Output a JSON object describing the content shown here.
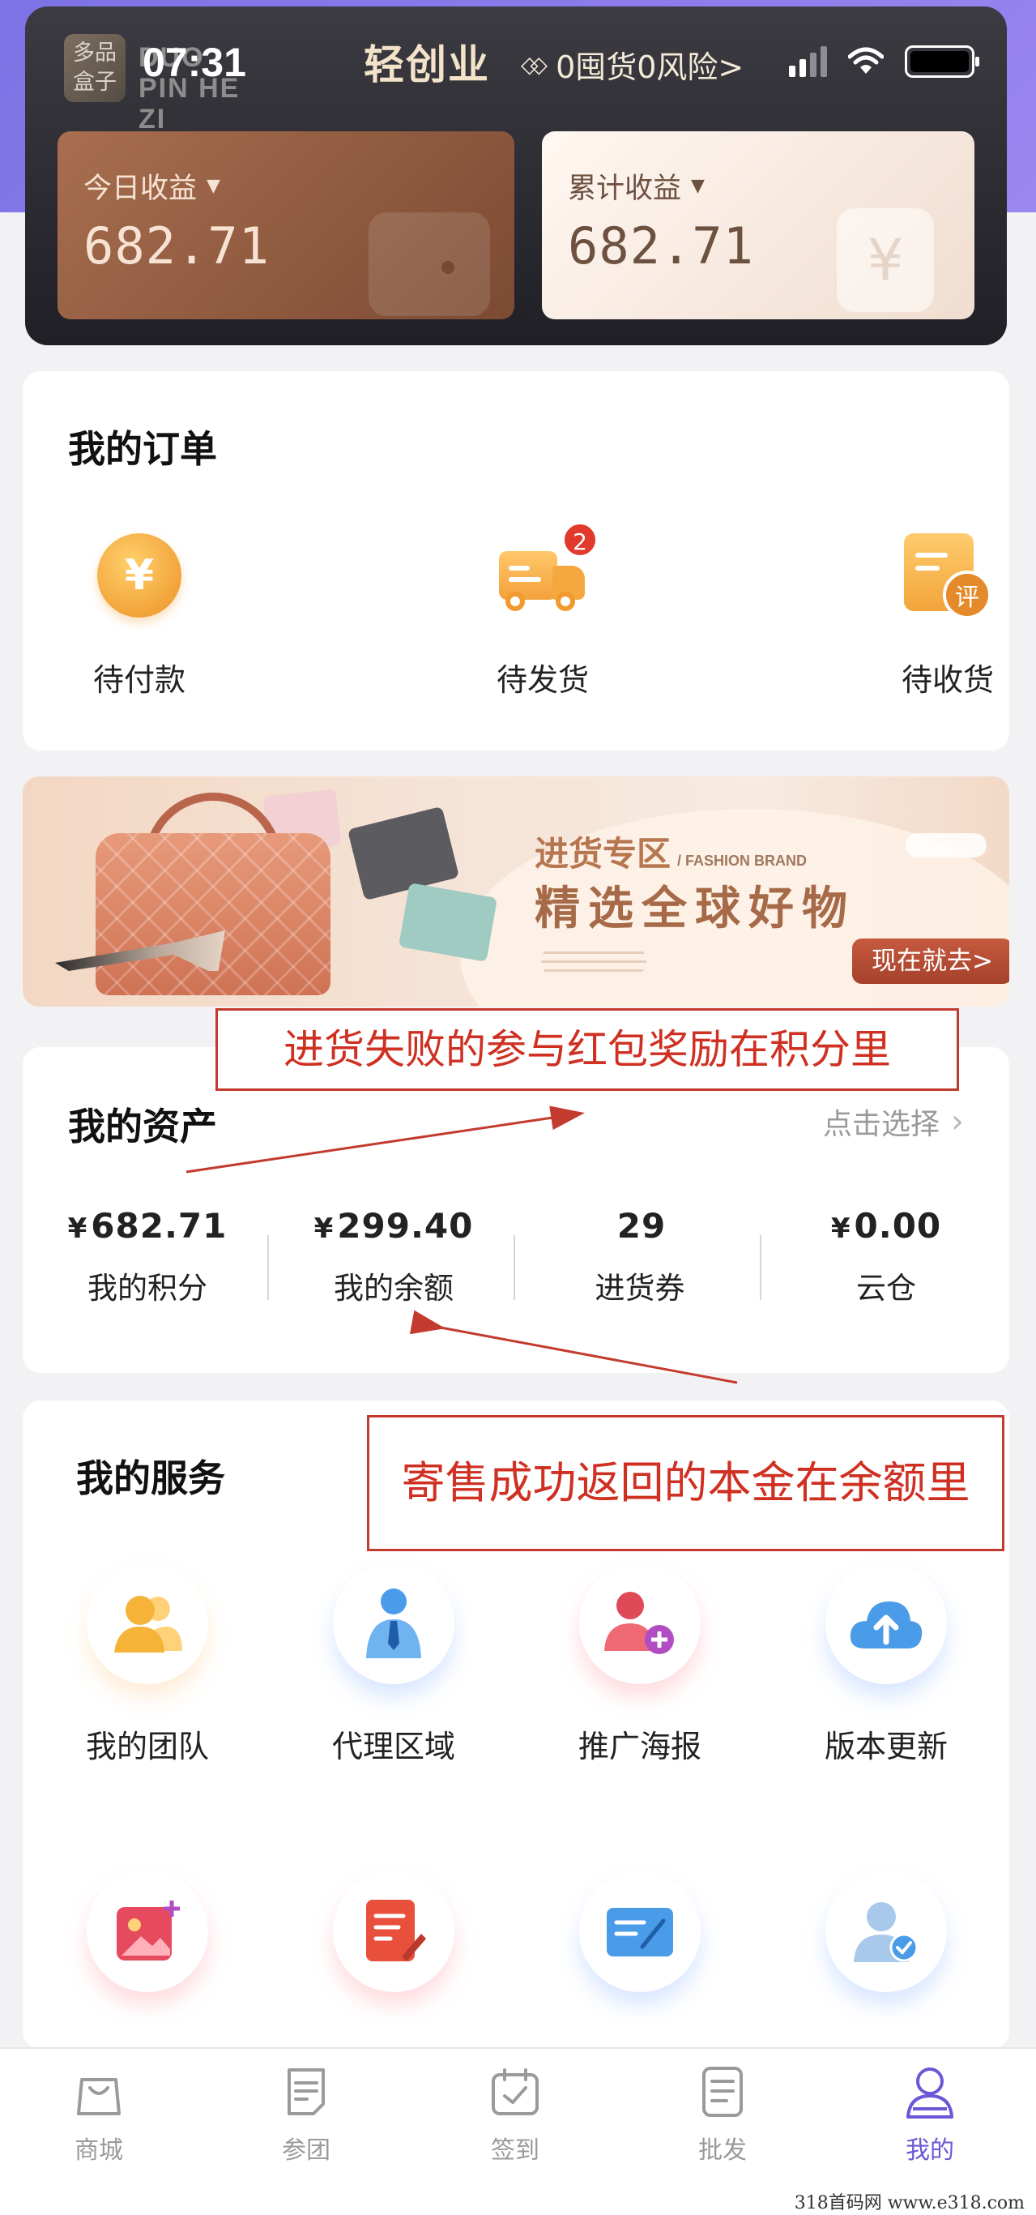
{
  "status_bar": {
    "time": "07:31"
  },
  "brand": {
    "logo_text": "多品盒子",
    "latin_text": "DUO PIN HE ZI"
  },
  "header": {
    "title": "轻创业",
    "slogan": "0囤货0风险>",
    "today_label": "今日收益",
    "today_value": "682.71",
    "total_label": "累计收益",
    "total_value": "682.71"
  },
  "orders": {
    "title": "我的订单",
    "items": [
      {
        "label": "待付款",
        "icon": "yen-coin-icon"
      },
      {
        "label": "待发货",
        "icon": "delivery-truck-icon",
        "badge": "2"
      },
      {
        "label": "待收货",
        "icon": "review-document-icon",
        "stamp": "评"
      }
    ]
  },
  "banner": {
    "kicker": "进货专区",
    "brand_tag": "/ FASHION BRAND",
    "headline": "精选全球好物",
    "cta": "现在就去>"
  },
  "annotations": {
    "note_points": "进货失败的参与红包奖励在积分里",
    "note_balance": "寄售成功返回的本金在余额里",
    "color": "#c33a2e"
  },
  "assets": {
    "title": "我的资产",
    "select_label": "点击选择",
    "items": [
      {
        "currency": "¥",
        "value": "682.71",
        "label": "我的积分"
      },
      {
        "currency": "¥",
        "value": "299.40",
        "label": "我的余额"
      },
      {
        "currency": "",
        "value": "29",
        "label": "进货券"
      },
      {
        "currency": "¥",
        "value": "0.00",
        "label": "云仓"
      }
    ]
  },
  "services": {
    "title": "我的服务",
    "items": [
      {
        "label": "我的团队",
        "icon": "team-icon"
      },
      {
        "label": "代理区域",
        "icon": "agent-icon"
      },
      {
        "label": "推广海报",
        "icon": "add-user-icon"
      },
      {
        "label": "版本更新",
        "icon": "cloud-upload-icon"
      },
      {
        "label": "",
        "icon": "image-add-icon"
      },
      {
        "label": "",
        "icon": "edit-document-icon"
      },
      {
        "label": "",
        "icon": "signature-card-icon"
      },
      {
        "label": "",
        "icon": "verified-user-icon"
      }
    ]
  },
  "tabbar": {
    "items": [
      {
        "label": "商城",
        "icon": "shopping-bag-icon"
      },
      {
        "label": "参团",
        "icon": "document-icon"
      },
      {
        "label": "签到",
        "icon": "calendar-check-icon"
      },
      {
        "label": "批发",
        "icon": "list-icon"
      },
      {
        "label": "我的",
        "icon": "user-icon",
        "active": true
      }
    ],
    "active_color": "#6b58d6"
  },
  "watermark": "318首码网  www.e318.com",
  "colors": {
    "accent_purple": "#7d72e6",
    "earn_brown": "#a86e4f",
    "badge_red": "#e1392c",
    "coin_orange": "#f2a43a"
  }
}
